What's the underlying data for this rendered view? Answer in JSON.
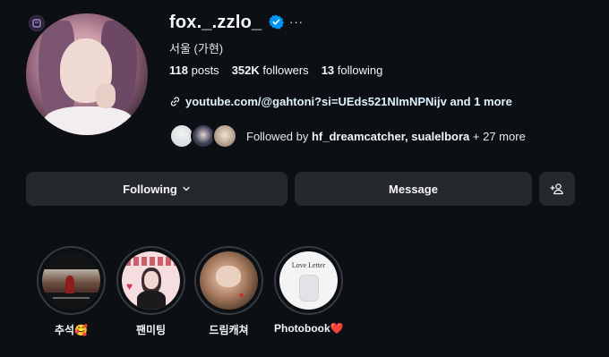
{
  "profile": {
    "username": "fox._.zzlo_",
    "location": "서울 (가현)",
    "stats": [
      {
        "value": "118",
        "label": "posts"
      },
      {
        "value": "352K",
        "label": "followers"
      },
      {
        "value": "13",
        "label": "following"
      }
    ],
    "link_text": "youtube.com/@gahtoni?si=UEds521NlmNPNijv and 1 more",
    "followed_prefix": "Followed by ",
    "followed_names": "hf_dreamcatcher, sualelbora",
    "followed_suffix": " + 27 more"
  },
  "actions": {
    "following_label": "Following",
    "message_label": "Message"
  },
  "highlights": [
    {
      "label": "추석🥰"
    },
    {
      "label": "팬미팅"
    },
    {
      "label": "드림캐쳐"
    },
    {
      "label": "Photobook❤️"
    }
  ],
  "highlight_texts": {
    "love_letter": "Love Letter"
  },
  "colors": {
    "background": "#0c1014",
    "button": "#25292e",
    "verified": "#0095f6"
  }
}
